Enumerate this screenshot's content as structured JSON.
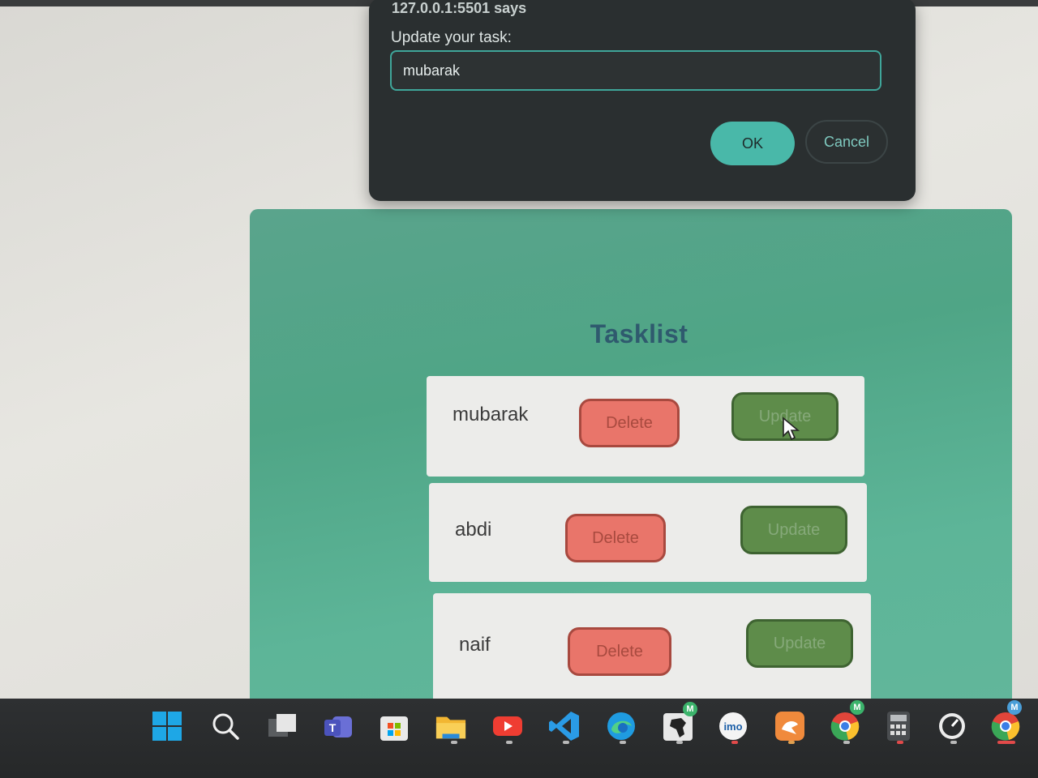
{
  "dialog": {
    "origin": "127.0.0.1:5501 says",
    "message": "Update your task:",
    "input_value": "mubarak",
    "ok_label": "OK",
    "cancel_label": "Cancel"
  },
  "app": {
    "title": "Tasklist",
    "tasks": [
      {
        "name": "mubarak",
        "delete_label": "Delete",
        "update_label": "Update"
      },
      {
        "name": "abdi",
        "delete_label": "Delete",
        "update_label": "Update"
      },
      {
        "name": "naif",
        "delete_label": "Delete",
        "update_label": "Update"
      }
    ]
  },
  "taskbar": {
    "icons": [
      "windows-start-icon",
      "search-icon",
      "task-view-icon",
      "teams-icon",
      "store-icon",
      "file-explorer-icon",
      "youtube-icon",
      "vscode-icon",
      "edge-icon",
      "africa-app-icon",
      "imo-icon",
      "pigeon-app-icon",
      "chrome-icon",
      "calculator-icon",
      "speedometer-icon",
      "chrome-icon"
    ],
    "imo_label": "imo",
    "badge_letter": "M"
  },
  "colors": {
    "accent_teal": "#49b8a9",
    "delete_red": "#e9756a",
    "update_green": "#5e8c4a",
    "app_bg": "#5aa48c"
  }
}
